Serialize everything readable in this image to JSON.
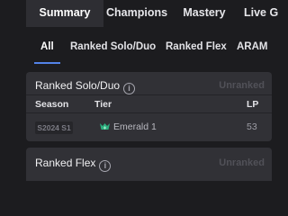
{
  "top_tabs": [
    {
      "label": "Summary"
    },
    {
      "label": "Champions"
    },
    {
      "label": "Mastery"
    },
    {
      "label": "Live G"
    }
  ],
  "sub_tabs": [
    {
      "label": "All"
    },
    {
      "label": "Ranked Solo/Duo"
    },
    {
      "label": "Ranked Flex"
    },
    {
      "label": "ARAM"
    }
  ],
  "solo_card": {
    "title": "Ranked Solo/Duo",
    "info_glyph": "i",
    "status": "Unranked",
    "columns": {
      "season": "Season",
      "tier": "Tier",
      "lp": "LP"
    },
    "row": {
      "season": "S2024 S1",
      "tier": "Emerald 1",
      "lp": "53"
    }
  },
  "flex_card": {
    "title": "Ranked Flex",
    "info_glyph": "i",
    "status": "Unranked"
  },
  "colors": {
    "accent": "#5383e8",
    "emerald": "#2daf7f",
    "card_bg": "#313136",
    "page_bg": "#1c1c1f"
  },
  "icons": {
    "info": "info-icon",
    "tier": "emerald-crest-icon"
  }
}
